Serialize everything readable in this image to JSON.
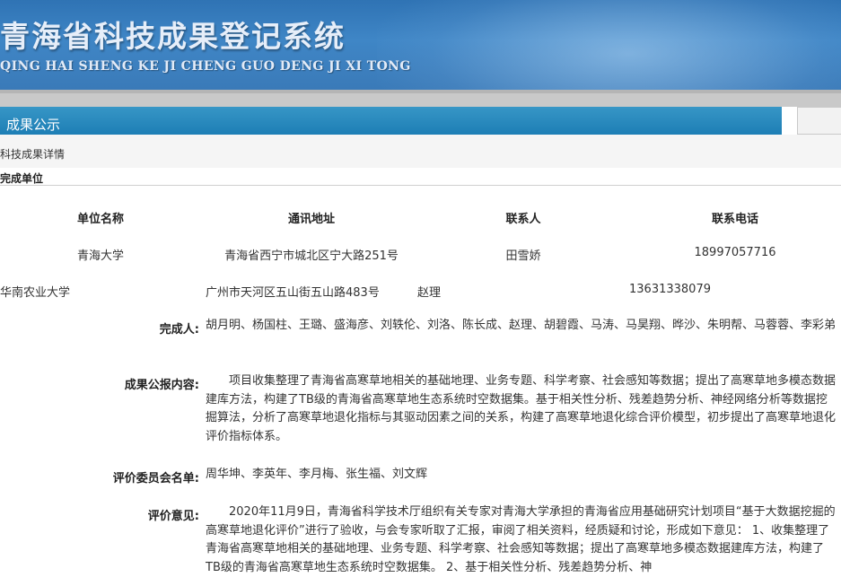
{
  "header": {
    "title_cn": "青海省科技成果登记系统",
    "title_en": "QING HAI SHENG KE JI CHENG GUO DENG JI XI TONG"
  },
  "panel": {
    "title": "成果公示"
  },
  "detail": {
    "title": "科技成果详情"
  },
  "unit_section": {
    "title": "完成单位"
  },
  "unit_table": {
    "headers": [
      "单位名称",
      "通讯地址",
      "联系人",
      "联系电话"
    ],
    "rows": [
      [
        "青海大学",
        "青海省西宁市城北区宁大路251号",
        "田雪娇",
        "18997057716"
      ],
      [
        "华南农业大学",
        "广州市天河区五山街五山路483号",
        "赵理",
        "13631338079"
      ]
    ]
  },
  "fields": {
    "completers_label": "完成人:",
    "completers": "胡月明、杨国柱、王璐、盛海彦、刘轶伦、刘洛、陈长成、赵理、胡碧霞、马涛、马昊翔、晔沙、朱明帮、马蓉蓉、李彩弟",
    "summary_label": "成果公报内容:",
    "summary": "项目收集整理了青海省高寒草地相关的基础地理、业务专题、科学考察、社会感知等数据；提出了高寒草地多模态数据建库方法，构建了TB级的青海省高寒草地生态系统时空数据集。基于相关性分析、残差趋势分析、神经网络分析等数据挖掘算法，分析了高寒草地退化指标与其驱动因素之间的关系，构建了高寒草地退化综合评价模型，初步提出了高寒草地退化评价指标体系。",
    "committee_label": "评价委员会名单:",
    "committee": "周华坤、李英年、李月梅、张生福、刘文辉",
    "opinion_label": "评价意见:",
    "opinion": "2020年11月9日，青海省科学技术厅组织有关专家对青海大学承担的青海省应用基础研究计划项目“基于大数据挖掘的高寒草地退化评价”进行了验收，与会专家听取了汇报，审阅了相关资料，经质疑和讨论，形成如下意见： 1、收集整理了青海省高寒草地相关的基础地理、业务专题、科学考察、社会感知等数据；提出了高寒草地多模态数据建库方法，构建了TB级的青海省高寒草地生态系统时空数据集。 2、基于相关性分析、残差趋势分析、神"
  }
}
